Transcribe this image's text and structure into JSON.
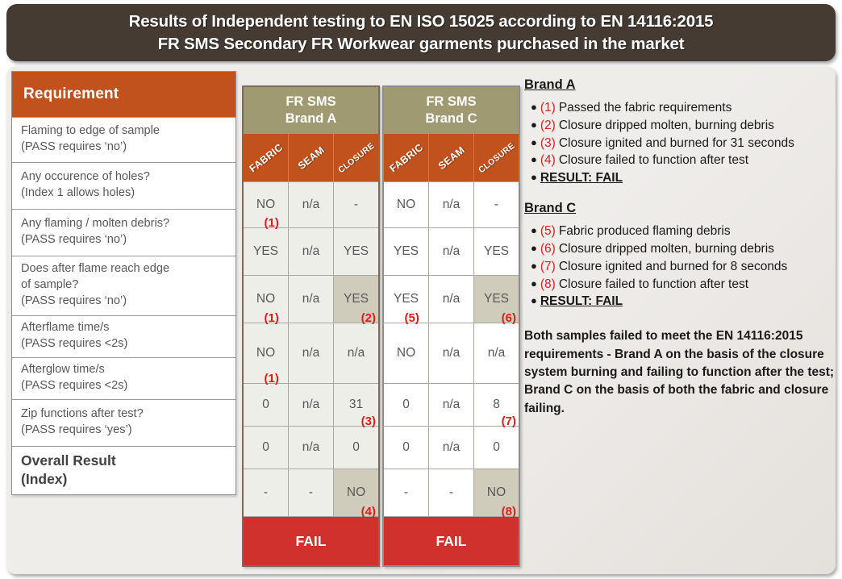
{
  "title": {
    "line1": "Results of Independent testing to EN ISO 15025  according to EN 14116:2015",
    "line2": "FR SMS Secondary FR Workwear garments purchased in the market"
  },
  "colors": {
    "title_bar": "#453b33",
    "accent_orange": "#c1511d",
    "olive_header": "#a09a73",
    "fail_red": "#d0312c",
    "highlight_cell": "#cfccbb",
    "note_red": "#e02020"
  },
  "requirement_column": {
    "header": "Requirement",
    "rows": [
      {
        "line1": "Flaming to edge of sample",
        "line2": "(PASS requires ‘no’)",
        "line3": ""
      },
      {
        "line1": "Any occurence of holes?",
        "line2": "(Index 1 allows holes)",
        "line3": ""
      },
      {
        "line1": "Any flaming / molten debris?",
        "line2": "(PASS requires ‘no’)",
        "line3": ""
      },
      {
        "line1": "Does after flame reach edge",
        "line2": "of sample?",
        "line3": "(PASS requires ‘no’)"
      },
      {
        "line1": "Afterflame time/s",
        "line2": "(PASS requires <2s)",
        "line3": ""
      },
      {
        "line1": "Afterglow time/s",
        "line2": "(PASS requires <2s)",
        "line3": ""
      },
      {
        "line1": "Zip functions after test?",
        "line2": "(PASS requires ‘yes’)",
        "line3": ""
      },
      {
        "line1": "Overall Result",
        "line2": "(Index)",
        "line3": ""
      }
    ]
  },
  "tables": [
    {
      "brand_title_line1": "FR SMS",
      "brand_title_line2": "Brand A",
      "columns": [
        "FABRIC",
        "SEAM",
        "CLOSURE"
      ],
      "rows": [
        {
          "cells": [
            {
              "value": "NO",
              "note": "(1)",
              "highlight": false
            },
            {
              "value": "n/a",
              "note": "",
              "highlight": false
            },
            {
              "value": "-",
              "note": "",
              "highlight": false
            }
          ]
        },
        {
          "cells": [
            {
              "value": "YES",
              "note": "",
              "highlight": false
            },
            {
              "value": "n/a",
              "note": "",
              "highlight": false
            },
            {
              "value": "YES",
              "note": "",
              "highlight": false
            }
          ]
        },
        {
          "cells": [
            {
              "value": "NO",
              "note": "(1)",
              "highlight": false
            },
            {
              "value": "n/a",
              "note": "",
              "highlight": false
            },
            {
              "value": "YES",
              "note": "(2)",
              "highlight": true
            }
          ]
        },
        {
          "cells": [
            {
              "value": "NO",
              "note": "(1)",
              "highlight": false
            },
            {
              "value": "n/a",
              "note": "",
              "highlight": false
            },
            {
              "value": "n/a",
              "note": "",
              "highlight": false
            }
          ]
        },
        {
          "cells": [
            {
              "value": "0",
              "note": "",
              "highlight": false
            },
            {
              "value": "n/a",
              "note": "",
              "highlight": false
            },
            {
              "value": "31",
              "note": "(3)",
              "highlight": false
            }
          ]
        },
        {
          "cells": [
            {
              "value": "0",
              "note": "",
              "highlight": false
            },
            {
              "value": "n/a",
              "note": "",
              "highlight": false
            },
            {
              "value": "0",
              "note": "",
              "highlight": false
            }
          ]
        },
        {
          "cells": [
            {
              "value": "-",
              "note": "",
              "highlight": false
            },
            {
              "value": "-",
              "note": "",
              "highlight": false
            },
            {
              "value": "NO",
              "note": "(4)",
              "highlight": true
            }
          ]
        }
      ],
      "overall": "FAIL"
    },
    {
      "brand_title_line1": "FR SMS",
      "brand_title_line2": "Brand C",
      "columns": [
        "FABRIC",
        "SEAM",
        "CLOSURE"
      ],
      "rows": [
        {
          "cells": [
            {
              "value": "NO",
              "note": "",
              "highlight": false
            },
            {
              "value": "n/a",
              "note": "",
              "highlight": false
            },
            {
              "value": "-",
              "note": "",
              "highlight": false
            }
          ]
        },
        {
          "cells": [
            {
              "value": "YES",
              "note": "",
              "highlight": false
            },
            {
              "value": "n/a",
              "note": "",
              "highlight": false
            },
            {
              "value": "YES",
              "note": "",
              "highlight": false
            }
          ]
        },
        {
          "cells": [
            {
              "value": "YES",
              "note": "(5)",
              "highlight": false
            },
            {
              "value": "n/a",
              "note": "",
              "highlight": false
            },
            {
              "value": "YES",
              "note": "(6)",
              "highlight": true
            }
          ]
        },
        {
          "cells": [
            {
              "value": "NO",
              "note": "",
              "highlight": false
            },
            {
              "value": "n/a",
              "note": "",
              "highlight": false
            },
            {
              "value": "n/a",
              "note": "",
              "highlight": false
            }
          ]
        },
        {
          "cells": [
            {
              "value": "0",
              "note": "",
              "highlight": false
            },
            {
              "value": "n/a",
              "note": "",
              "highlight": false
            },
            {
              "value": "8",
              "note": "(7)",
              "highlight": false
            }
          ]
        },
        {
          "cells": [
            {
              "value": "0",
              "note": "",
              "highlight": false
            },
            {
              "value": "n/a",
              "note": "",
              "highlight": false
            },
            {
              "value": "0",
              "note": "",
              "highlight": false
            }
          ]
        },
        {
          "cells": [
            {
              "value": "-",
              "note": "",
              "highlight": false
            },
            {
              "value": "-",
              "note": "",
              "highlight": false
            },
            {
              "value": "NO",
              "note": "(8)",
              "highlight": true
            }
          ]
        }
      ],
      "overall": "FAIL"
    }
  ],
  "notes": {
    "brand_a_heading": "Brand A",
    "brand_a_items": [
      {
        "num": "(1)",
        "text": "Passed the fabric requirements",
        "result": false
      },
      {
        "num": "(2)",
        "text": "Closure dripped molten, burning debris",
        "result": false
      },
      {
        "num": "(3)",
        "text": "Closure ignited and burned for 31 seconds",
        "result": false
      },
      {
        "num": "(4)",
        "text": "Closure failed to function after test",
        "result": false
      },
      {
        "num": "",
        "text": "RESULT: FAIL",
        "result": true
      }
    ],
    "brand_c_heading": "Brand C",
    "brand_c_items": [
      {
        "num": "(5)",
        "text": "Fabric produced flaming debris",
        "result": false
      },
      {
        "num": "(6)",
        "text": "Closure dripped molten, burning debris",
        "result": false
      },
      {
        "num": "(7)",
        "text": "Closure ignited and burned for 8 seconds",
        "result": false
      },
      {
        "num": "(8)",
        "text": "Closure failed to function after test",
        "result": false
      },
      {
        "num": "",
        "text": "RESULT: FAIL",
        "result": true
      }
    ],
    "summary": "Both samples failed to meet the EN 14116:2015 requirements - Brand A on the basis of the closure system burning and failing to function after the test; Brand C on the basis of both the fabric and closure failing."
  }
}
